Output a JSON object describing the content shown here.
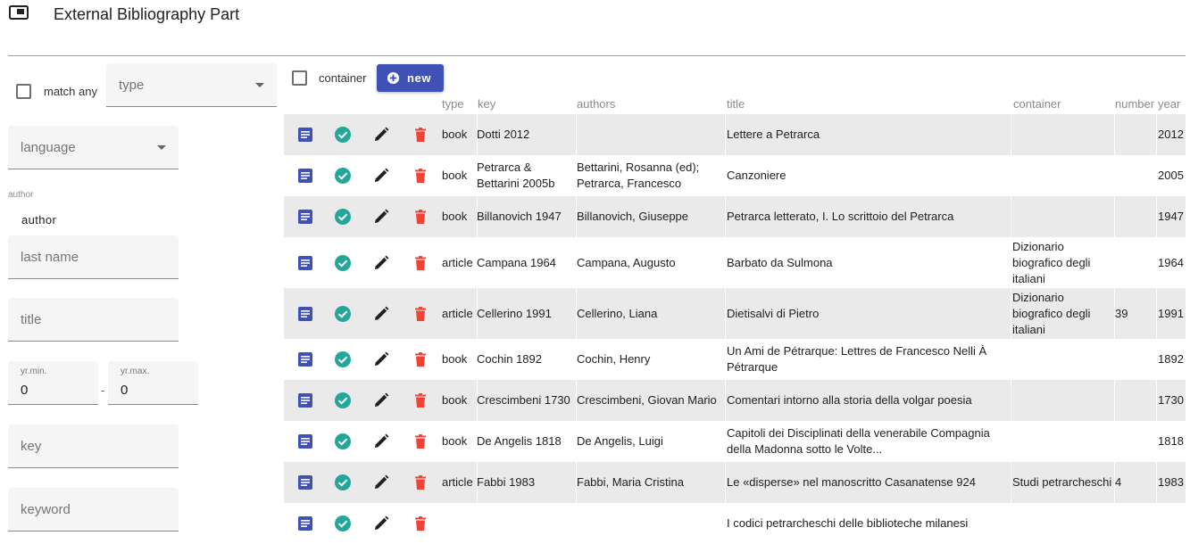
{
  "header": {
    "title": "External Bibliography Part"
  },
  "filters": {
    "match_any_label": "match any",
    "type_placeholder": "type",
    "language_placeholder": "language",
    "author_section_label": "author",
    "author_section_title": "author",
    "last_name_placeholder": "last name",
    "title_placeholder": "title",
    "yr_min_label": "yr.min.",
    "yr_min_value": "0",
    "yr_max_label": "yr.max.",
    "yr_max_value": "0",
    "range_separator": "-",
    "key_placeholder": "key",
    "keyword_placeholder": "keyword"
  },
  "toolbar": {
    "container_label": "container",
    "new_label": "new"
  },
  "table": {
    "columns": {
      "type": "type",
      "key": "key",
      "authors": "authors",
      "title": "title",
      "container": "container",
      "number": "number",
      "year": "year"
    },
    "rows": [
      {
        "type": "book",
        "key": "Dotti 2012",
        "authors": "",
        "title": "Lettere a Petrarca",
        "container": "",
        "number": "",
        "year": "2012"
      },
      {
        "type": "book",
        "key": "Petrarca & Bettarini 2005b",
        "authors": "Bettarini, Rosanna (ed); Petrarca, Francesco",
        "title": "Canzoniere",
        "container": "",
        "number": "",
        "year": "2005"
      },
      {
        "type": "book",
        "key": "Billanovich 1947",
        "authors": "Billanovich, Giuseppe",
        "title": "Petrarca letterato, I. Lo scrittoio del Petrarca",
        "container": "",
        "number": "",
        "year": "1947"
      },
      {
        "type": "article",
        "key": "Campana 1964",
        "authors": "Campana, Augusto",
        "title": "Barbato da Sulmona",
        "container": "Dizionario biografico degli italiani",
        "number": "",
        "year": "1964"
      },
      {
        "type": "article",
        "key": "Cellerino 1991",
        "authors": "Cellerino, Liana",
        "title": "Dietisalvi di Pietro",
        "container": "Dizionario biografico degli italiani",
        "number": "39",
        "year": "1991"
      },
      {
        "type": "book",
        "key": "Cochin 1892",
        "authors": "Cochin, Henry",
        "title": "Un Ami de Pétrarque: Lettres de Francesco Nelli À Pétrarque",
        "container": "",
        "number": "",
        "year": "1892"
      },
      {
        "type": "book",
        "key": "Crescimbeni 1730",
        "authors": "Crescimbeni, Giovan Mario",
        "title": "Comentari intorno alla storia della volgar poesia",
        "container": "",
        "number": "",
        "year": "1730"
      },
      {
        "type": "book",
        "key": "De Angelis 1818",
        "authors": "De Angelis, Luigi",
        "title": "Capitoli dei Disciplinati della venerabile Compagnia della Madonna sotto le Volte...",
        "container": "",
        "number": "",
        "year": "1818"
      },
      {
        "type": "article",
        "key": "Fabbi 1983",
        "authors": "Fabbi, Maria Cristina",
        "title": "Le «disperse» nel manoscritto Casanatense 924",
        "container": "Studi petrarcheschi",
        "number": "4",
        "year": "1983"
      },
      {
        "type": "",
        "key": "",
        "authors": "",
        "title": "I codici petrarcheschi delle biblioteche milanesi",
        "container": "",
        "number": "",
        "year": ""
      }
    ]
  },
  "colors": {
    "primary": "#3f51b5",
    "success": "#26a69a",
    "danger": "#f44336",
    "row_shade": "#eaeaea"
  },
  "icons": [
    "panel-icon",
    "plus-circle-icon",
    "document-icon",
    "check-circle-icon",
    "pencil-icon",
    "trash-icon"
  ]
}
